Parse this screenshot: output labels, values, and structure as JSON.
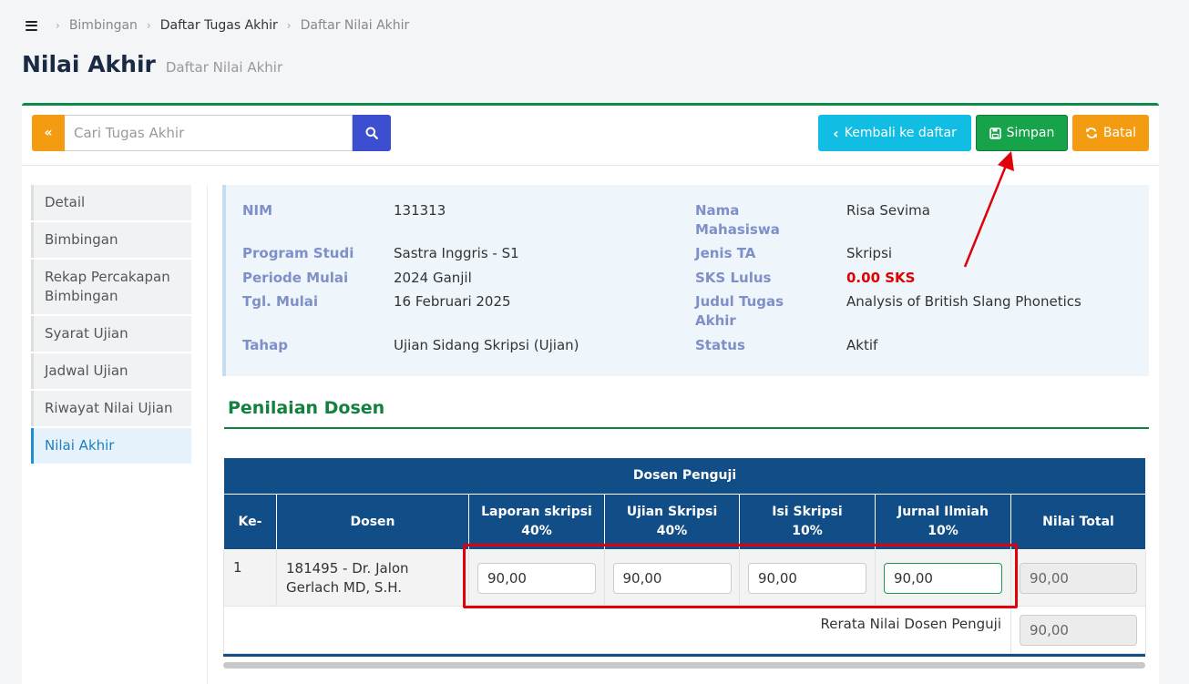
{
  "breadcrumb": {
    "items": [
      "Bimbingan",
      "Daftar Tugas Akhir",
      "Daftar Nilai Akhir"
    ]
  },
  "page": {
    "title": "Nilai Akhir",
    "subtitle": "Daftar Nilai Akhir"
  },
  "toolbar": {
    "search_placeholder": "Cari Tugas Akhir",
    "back_label": "Kembali ke daftar",
    "save_label": "Simpan",
    "cancel_label": "Batal"
  },
  "sidebar": {
    "items": [
      "Detail",
      "Bimbingan",
      "Rekap Percakapan Bimbingan",
      "Syarat Ujian",
      "Jadwal Ujian",
      "Riwayat Nilai Ujian",
      "Nilai Akhir"
    ],
    "active": "Nilai Akhir"
  },
  "info": {
    "nim_label": "NIM",
    "nim": "131313",
    "nama_label": "Nama Mahasiswa",
    "nama": "Risa Sevima",
    "prodi_label": "Program Studi",
    "prodi": "Sastra Inggris - S1",
    "jenis_label": "Jenis TA",
    "jenis": "Skripsi",
    "periode_label": "Periode Mulai",
    "periode": "2024 Ganjil",
    "sks_label": "SKS Lulus",
    "sks": "0.00 SKS",
    "tgl_label": "Tgl. Mulai",
    "tgl": "16 Februari 2025",
    "judul_label": "Judul Tugas Akhir",
    "judul": "Analysis of British Slang Phonetics",
    "tahap_label": "Tahap",
    "tahap": "Ujian Sidang Skripsi (Ujian)",
    "status_label": "Status",
    "status": "Aktif"
  },
  "section": {
    "title": "Penilaian Dosen"
  },
  "table": {
    "group_header": "Dosen Penguji",
    "col_no": "Ke-",
    "col_dosen": "Dosen",
    "col_laporan": "Laporan skripsi",
    "col_laporan_w": "40%",
    "col_ujian": "Ujian Skripsi",
    "col_ujian_w": "40%",
    "col_isi": "Isi Skripsi",
    "col_isi_w": "10%",
    "col_jurnal": "Jurnal Ilmiah",
    "col_jurnal_w": "10%",
    "col_total": "Nilai Total",
    "rows": [
      {
        "no": "1",
        "dosen": "181495 - Dr. Jalon Gerlach MD, S.H.",
        "laporan": "90,00",
        "ujian": "90,00",
        "isi": "90,00",
        "jurnal": "90,00",
        "total": "90,00"
      }
    ],
    "avg_label": "Rerata Nilai Dosen Penguji",
    "avg_value": "90,00"
  },
  "colors": {
    "primary_green": "#16a34a",
    "header_blue": "#114d86",
    "accent_orange": "#f39c12",
    "info_cyan": "#11bde3",
    "annotation_red": "#e0000a"
  }
}
